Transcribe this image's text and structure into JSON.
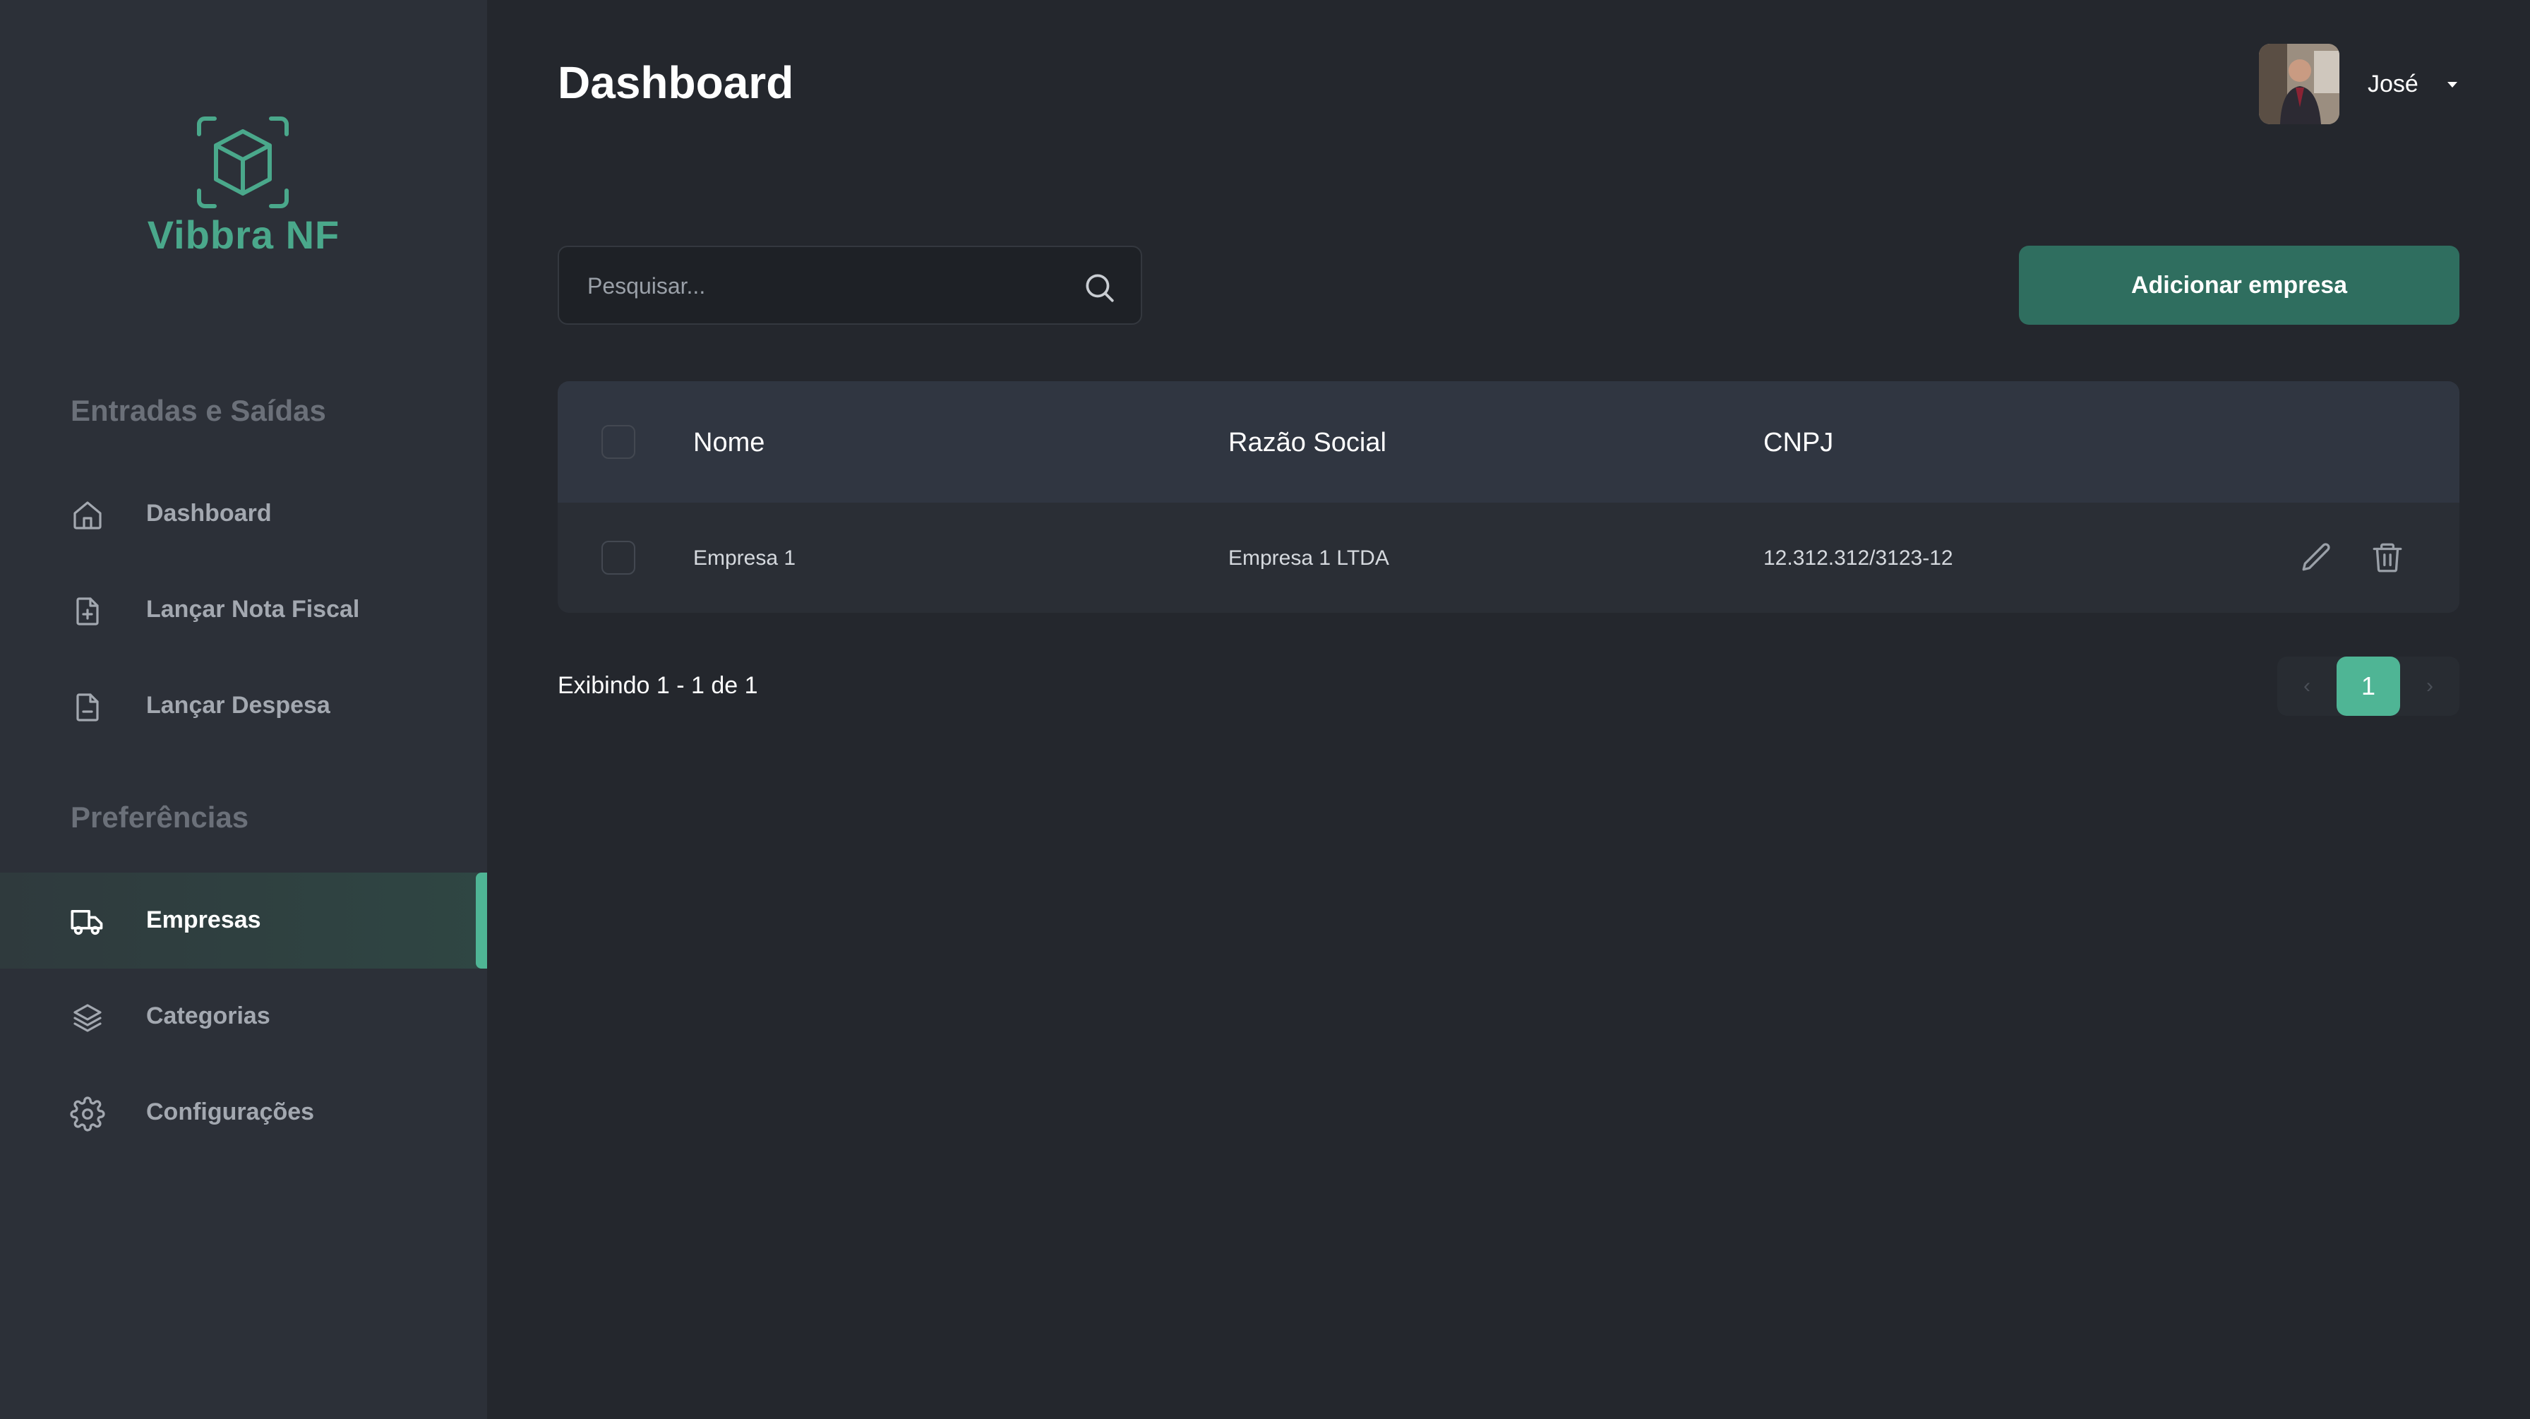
{
  "brand": {
    "name": "Vibbra NF",
    "accent": "#4fb595"
  },
  "sidebar": {
    "sections": [
      {
        "title": "Entradas e Saídas"
      },
      {
        "title": "Preferências"
      }
    ],
    "items": [
      {
        "label": "Dashboard",
        "icon": "home-icon"
      },
      {
        "label": "Lançar Nota Fiscal",
        "icon": "file-plus-icon"
      },
      {
        "label": "Lançar Despesa",
        "icon": "file-minus-icon"
      },
      {
        "label": "Empresas",
        "icon": "truck-icon",
        "active": true
      },
      {
        "label": "Categorias",
        "icon": "layers-icon"
      },
      {
        "label": "Configurações",
        "icon": "gear-icon"
      }
    ]
  },
  "header": {
    "title": "Dashboard",
    "user": {
      "name": "José"
    }
  },
  "toolbar": {
    "search_placeholder": "Pesquisar...",
    "add_label": "Adicionar empresa"
  },
  "table": {
    "columns": [
      "Nome",
      "Razão Social",
      "CNPJ"
    ],
    "rows": [
      {
        "nome": "Empresa 1",
        "razao_social": "Empresa 1 LTDA",
        "cnpj": "12.312.312/3123-12"
      }
    ]
  },
  "pagination": {
    "summary": "Exibindo 1 - 1 de 1",
    "prev": "‹",
    "current": "1",
    "next": "›"
  }
}
